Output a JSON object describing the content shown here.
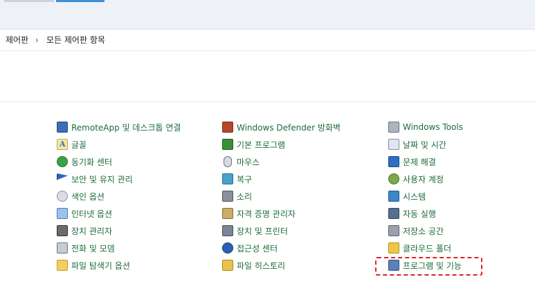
{
  "breadcrumb": {
    "root": "제어판",
    "separator": "›",
    "current": "모든 제어판 항목"
  },
  "items": {
    "col1": [
      {
        "label": "RemoteApp 및 데스크톱 연결",
        "icon": "remote-desktop-icon"
      },
      {
        "label": "글꼴",
        "icon": "font-icon"
      },
      {
        "label": "동기화 센터",
        "icon": "sync-icon"
      },
      {
        "label": "보안 및 유지 관리",
        "icon": "flag-icon"
      },
      {
        "label": "색인 옵션",
        "icon": "index-icon"
      },
      {
        "label": "인터넷 옵션",
        "icon": "internet-icon"
      },
      {
        "label": "장치 관리자",
        "icon": "device-manager-icon"
      },
      {
        "label": "전화 및 모뎀",
        "icon": "phone-icon"
      },
      {
        "label": "파일 탐색기 옵션",
        "icon": "folder-icon"
      }
    ],
    "col2": [
      {
        "label": "Windows Defender 방화벽",
        "icon": "firewall-icon"
      },
      {
        "label": "기본 프로그램",
        "icon": "default-programs-icon"
      },
      {
        "label": "마우스",
        "icon": "mouse-icon"
      },
      {
        "label": "복구",
        "icon": "recovery-icon"
      },
      {
        "label": "소리",
        "icon": "sound-icon"
      },
      {
        "label": "자격 증명 관리자",
        "icon": "credential-icon"
      },
      {
        "label": "장치 및 프린터",
        "icon": "printer-icon"
      },
      {
        "label": "접근성 센터",
        "icon": "accessibility-icon"
      },
      {
        "label": "파일 히스토리",
        "icon": "file-history-icon"
      }
    ],
    "col3": [
      {
        "label": "Windows Tools",
        "icon": "tools-icon"
      },
      {
        "label": "날짜 및 시간",
        "icon": "date-time-icon"
      },
      {
        "label": "문제 해결",
        "icon": "troubleshoot-icon"
      },
      {
        "label": "사용자 계정",
        "icon": "users-icon"
      },
      {
        "label": "시스템",
        "icon": "system-icon"
      },
      {
        "label": "자동 실행",
        "icon": "autoplay-icon"
      },
      {
        "label": "저장소 공간",
        "icon": "storage-icon"
      },
      {
        "label": "클라우드 폴더",
        "icon": "cloud-folder-icon"
      },
      {
        "label": "프로그램 및 기능",
        "icon": "programs-icon"
      }
    ]
  },
  "colors": {
    "link": "#1a6b3a",
    "highlight": "#e02020"
  }
}
